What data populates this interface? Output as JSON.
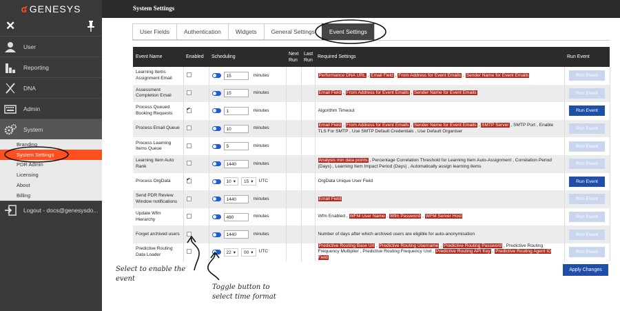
{
  "app": {
    "brand": "GENESYS",
    "page_title": "System Settings"
  },
  "sidebar": {
    "items": [
      {
        "label": "User",
        "icon": "user-icon"
      },
      {
        "label": "Reporting",
        "icon": "bar-chart-icon"
      },
      {
        "label": "DNA",
        "icon": "dna-icon"
      },
      {
        "label": "Admin",
        "icon": "keyboard-icon"
      },
      {
        "label": "System",
        "icon": "gears-icon"
      }
    ],
    "sub_items": [
      "Branding",
      "System Settings",
      "PDR Admin",
      "Licensing",
      "About",
      "Billing"
    ],
    "logout": "Logout - docs@genesysdo..."
  },
  "tabs": [
    "User Fields",
    "Authentication",
    "Widgets",
    "General Settings",
    "Event Settings"
  ],
  "table": {
    "headers": {
      "event_name": "Event Name",
      "enabled": "Enabled",
      "scheduling": "Scheduling",
      "next_run": "Next Run",
      "last_run": "Last Run",
      "required": "Required Settings",
      "run_event": "Run Event"
    },
    "rows": [
      {
        "name": "Learning Items Assignment Email",
        "value": "15",
        "unit": "minutes",
        "settings": [
          {
            "t": "Performance DNA URL",
            "h": true
          },
          {
            "t": " , "
          },
          {
            "t": "Email Field",
            "h": true
          },
          {
            "t": " , "
          },
          {
            "t": "From Address for Event Emails",
            "h": true
          },
          {
            "t": " , "
          },
          {
            "t": "Sender Name for Event Emails",
            "h": true
          }
        ],
        "run": "Run Event"
      },
      {
        "name": "Assessment Completion Email",
        "value": "15",
        "unit": "minutes",
        "settings": [
          {
            "t": "Email Field",
            "h": true
          },
          {
            "t": " , "
          },
          {
            "t": "From Address for Event Emails",
            "h": true
          },
          {
            "t": " , "
          },
          {
            "t": "Sender Name for Event Emails",
            "h": true
          }
        ],
        "run": "Run Event"
      },
      {
        "name": "Process Queued Booking Requests",
        "value": "1",
        "unit": "minutes",
        "settings": [
          {
            "t": "Algorithm Timeout"
          }
        ],
        "run": "Run Event"
      },
      {
        "name": "Process Email Queue",
        "value": "10",
        "unit": "minutes",
        "settings": [
          {
            "t": "Email Field",
            "h": true
          },
          {
            "t": " , "
          },
          {
            "t": "From Address for Event Emails",
            "h": true
          },
          {
            "t": " , "
          },
          {
            "t": "Sender Name for Event Emails",
            "h": true
          },
          {
            "t": " , "
          },
          {
            "t": "SMTP Server",
            "h": true
          },
          {
            "t": " , SMTP Port , Enable TLS For SMTP , Use SMTP Default Credentials , Use Default Organiser"
          }
        ],
        "run": "Run Event"
      },
      {
        "name": "Process Learning Items Queue",
        "value": "5",
        "unit": "minutes",
        "settings": [],
        "run": "Run Event"
      },
      {
        "name": "Learning Item Auto Rank",
        "value": "1440",
        "unit": "minutes",
        "settings": [
          {
            "t": "Analysis min data points",
            "h": true
          },
          {
            "t": " , Percentage Correlation Threshold for Learning Item Auto-Assignment , Correlation Period (Days) , Learning Item Impact Period (Days) , Automatically assign learning items"
          }
        ],
        "run": "Run Event"
      },
      {
        "name": "Process OrgData",
        "time_h": "10",
        "time_m": "15",
        "unit": "UTC",
        "settings": [
          {
            "t": "OrgData Unique User Field"
          }
        ],
        "run": "Run Event"
      },
      {
        "name": "Send PDR Review Window notifications",
        "value": "1440",
        "unit": "minutes",
        "settings": [
          {
            "t": "Email Field",
            "h": true
          }
        ],
        "run": "Run Event"
      },
      {
        "name": "Update Wfm Hierarchy",
        "value": "480",
        "unit": "minutes",
        "settings": [
          {
            "t": "Wfm Enabled , "
          },
          {
            "t": "WFM User Name",
            "h": true
          },
          {
            "t": " , "
          },
          {
            "t": "Wfm Password",
            "h": true
          },
          {
            "t": " , "
          },
          {
            "t": "WFM Server Host",
            "h": true
          }
        ],
        "run": "Run Event"
      },
      {
        "name": "Forget archived users",
        "value": "1440",
        "unit": "minutes",
        "settings": [
          {
            "t": "Number of days after which archived users are eligible for auto-anonymisation"
          }
        ],
        "run": "Run Event"
      },
      {
        "name": "Predictive Routing Data Loader",
        "time_h": "22",
        "time_m": "00",
        "unit": "UTC",
        "settings": [
          {
            "t": "Predictive Routing Base Url",
            "h": true
          },
          {
            "t": " , "
          },
          {
            "t": "Predictive Routing Username",
            "h": true
          },
          {
            "t": " , "
          },
          {
            "t": "Predictive Routing Password",
            "h": true
          },
          {
            "t": " , Predictive Routing Frequency Multiplier , Predictive Routing Frequency Unit , "
          },
          {
            "t": "Predictive Routing API Key",
            "h": true
          },
          {
            "t": " , "
          },
          {
            "t": "Predictive Routing Agent ID Field",
            "h": true
          }
        ],
        "run": "Run Event"
      }
    ]
  },
  "apply_label": "Apply Changes",
  "annotations": {
    "enable": "Select to enable the event",
    "toggle": "Toggle button to select time format"
  },
  "colors": {
    "accent": "#ff4f1f",
    "highlight": "#b22a1e",
    "primary": "#1f4fa8",
    "dark": "#2b2b2b"
  }
}
